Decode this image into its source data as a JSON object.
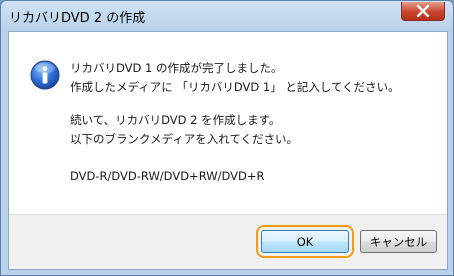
{
  "window": {
    "title": "リカバリDVD 2 の作成"
  },
  "dialog": {
    "lines": [
      "リカバリDVD 1 の作成が完了しました。",
      "作成したメディアに 「リカバリDVD 1」 と記入してください。",
      "続いて、リカバリDVD 2 を作成します。",
      "以下のブランクメディアを入れてください。",
      "DVD-R/DVD-RW/DVD+RW/DVD+R"
    ],
    "icon": "information-icon"
  },
  "buttons": {
    "ok": "OK",
    "cancel": "キャンセル"
  },
  "colors": {
    "focus_highlight": "#f39c12",
    "title_bar": "#b9d1ea",
    "close_button": "#c7432d"
  }
}
